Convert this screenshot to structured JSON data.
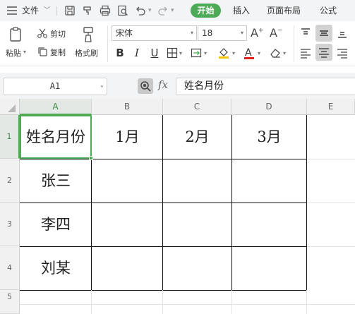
{
  "menubar": {
    "file_label": "文件",
    "tabs": [
      "开始",
      "插入",
      "页面布局",
      "公式"
    ]
  },
  "ribbon": {
    "paste_label": "粘贴",
    "cut_label": "剪切",
    "copy_label": "复制",
    "format_painter_label": "格式刷",
    "font_name": "宋体",
    "font_size": "18",
    "bold": "B",
    "italic": "I",
    "underline": "U",
    "fill_color": "#f5c400",
    "font_color": "#e0221f"
  },
  "formula_bar": {
    "cell_ref": "A1",
    "fx": "fx",
    "content": "姓名月份"
  },
  "sheet": {
    "columns": [
      "A",
      "B",
      "C",
      "D",
      "E"
    ],
    "rows": [
      "1",
      "2",
      "3",
      "4",
      "5"
    ],
    "cells": [
      [
        "姓名月份",
        "1月",
        "2月",
        "3月"
      ],
      [
        "张三",
        "",
        "",
        ""
      ],
      [
        "李四",
        "",
        "",
        ""
      ],
      [
        "刘某",
        "",
        "",
        ""
      ]
    ],
    "selected_cell": "A1"
  },
  "colors": {
    "accent": "#4daa57",
    "selection": "#4daa57"
  }
}
